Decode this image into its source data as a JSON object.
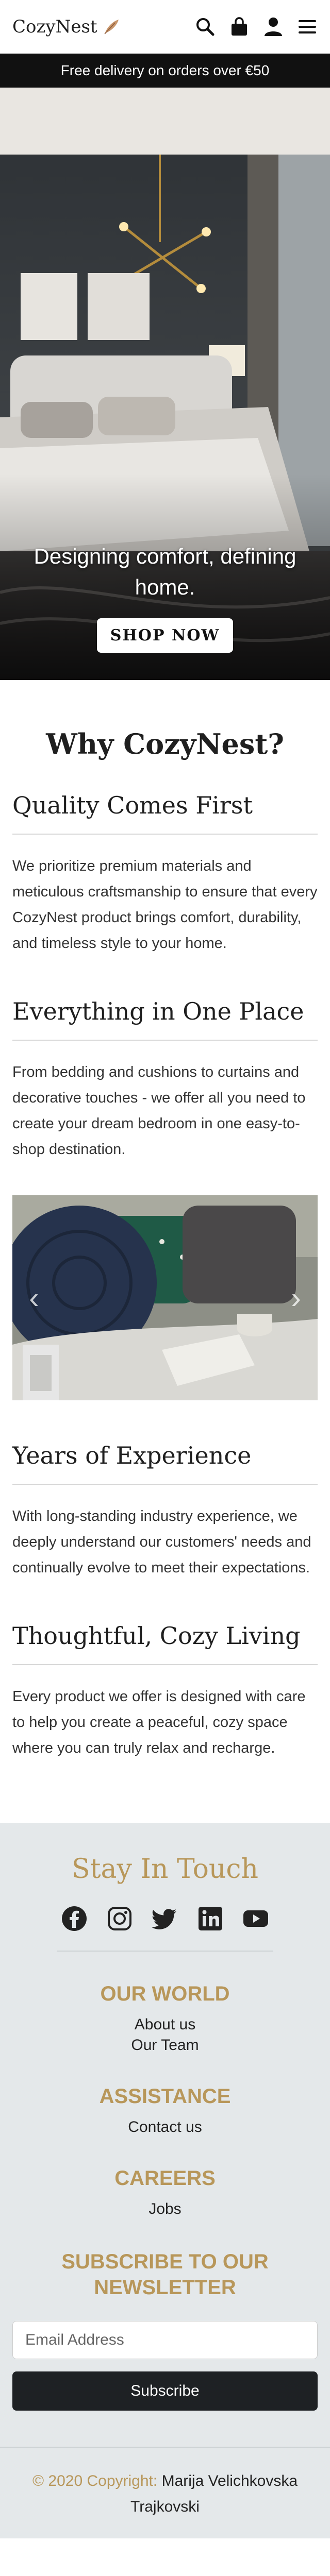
{
  "header": {
    "logo_text": "CozyNest",
    "icons": [
      "feather-logo-icon",
      "search-icon",
      "shopping-bag-icon",
      "user-icon",
      "menu-icon"
    ]
  },
  "promo": {
    "text": "Free delivery on orders over €50"
  },
  "hero": {
    "title": "Designing comfort, defining home.",
    "button_label": "SHOP NOW"
  },
  "why": {
    "title": "Why CozyNest?",
    "features": [
      {
        "title": "Quality Comes First",
        "text": "We prioritize premium materials and meticulous craftsmanship to ensure that every CozyNest product brings comfort, durability, and timeless style to your home."
      },
      {
        "title": "Everything in One Place",
        "text": "From bedding and cushions to curtains and decorative touches - we offer all you need to create your dream bedroom in one easy-to-shop destination."
      },
      {
        "title": "Years of Experience",
        "text": "With long-standing industry experience, we deeply understand our customers' needs and continually evolve to meet their expectations."
      },
      {
        "title": "Thoughtful, Cozy Living",
        "text": "Every product we offer is designed with care to help you create a peaceful, cozy space where you can truly relax and recharge."
      }
    ],
    "carousel": {
      "prev_glyph": "‹",
      "next_glyph": "›"
    }
  },
  "footer": {
    "stay_title": "Stay In Touch",
    "social_icons": [
      "facebook-icon",
      "instagram-icon",
      "twitter-icon",
      "linkedin-icon",
      "youtube-icon"
    ],
    "sections": [
      {
        "title": "OUR WORLD",
        "links": [
          "About us",
          "Our Team"
        ]
      },
      {
        "title": "ASSISTANCE",
        "links": [
          "Contact us"
        ]
      },
      {
        "title": "CAREERS",
        "links": [
          "Jobs"
        ]
      }
    ],
    "newsletter_title": "SUBSCRIBE TO OUR NEWSLETTER",
    "email_placeholder": "Email Address",
    "subscribe_label": "Subscribe",
    "copyright_prefix": "© 2020 Copyright:",
    "copyright_name": "Marija Velichkovska Trajkovski"
  },
  "colors": {
    "accent_gold": "#b8975a",
    "promo_bg": "#111111",
    "footer_bg": "#e4e8ea",
    "button_dark": "#1e2124"
  }
}
